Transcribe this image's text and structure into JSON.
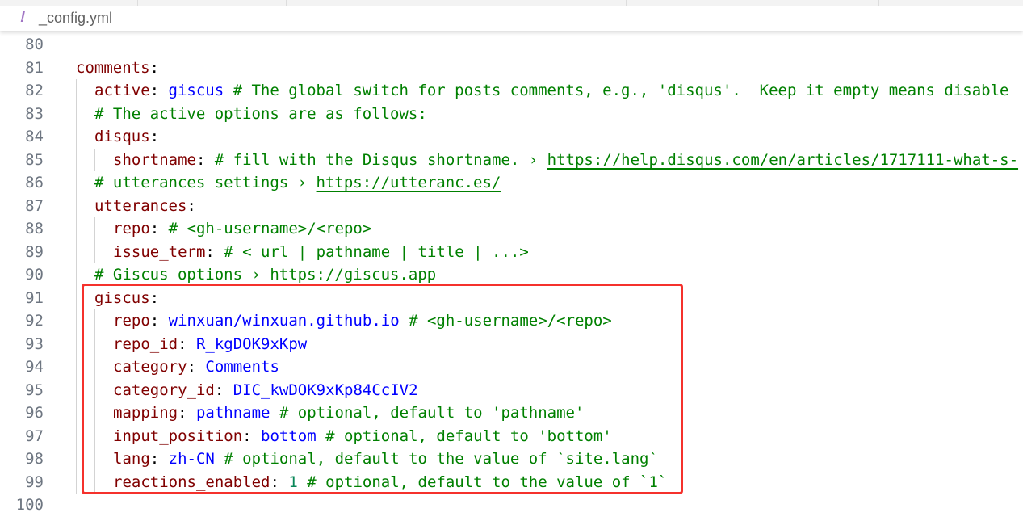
{
  "tab": {
    "filename": "_config.yml",
    "file_icon": "yaml-exclamation-icon",
    "icon_glyph": "!"
  },
  "colors": {
    "key": "#800000",
    "value": "#0000ff",
    "comment": "#008000",
    "number": "#098658",
    "highlight_box": "#f5312c"
  },
  "lines": [
    {
      "num": "80",
      "indent": 0,
      "tokens": []
    },
    {
      "num": "81",
      "indent": 0,
      "tokens": [
        {
          "t": "comments",
          "c": "k"
        },
        {
          "t": ":",
          "c": "p"
        }
      ]
    },
    {
      "num": "82",
      "indent": 1,
      "tokens": [
        {
          "t": "active",
          "c": "k"
        },
        {
          "t": ": ",
          "c": "p"
        },
        {
          "t": "giscus",
          "c": "v"
        },
        {
          "t": " # The global switch for posts comments, e.g., 'disqus'.  Keep it empty means disable",
          "c": "c"
        }
      ]
    },
    {
      "num": "83",
      "indent": 1,
      "tokens": [
        {
          "t": "# The active options are as follows:",
          "c": "c"
        }
      ]
    },
    {
      "num": "84",
      "indent": 1,
      "tokens": [
        {
          "t": "disqus",
          "c": "k"
        },
        {
          "t": ":",
          "c": "p"
        }
      ]
    },
    {
      "num": "85",
      "indent": 2,
      "tokens": [
        {
          "t": "shortname",
          "c": "k"
        },
        {
          "t": ": ",
          "c": "p"
        },
        {
          "t": "# fill with the Disqus shortname. › ",
          "c": "c"
        },
        {
          "t": "https://help.disqus.com/en/articles/1717111-what-s-",
          "c": "c u"
        }
      ]
    },
    {
      "num": "86",
      "indent": 1,
      "tokens": [
        {
          "t": "# utterances settings › ",
          "c": "c"
        },
        {
          "t": "https://utteranc.es/",
          "c": "c u"
        }
      ]
    },
    {
      "num": "87",
      "indent": 1,
      "tokens": [
        {
          "t": "utterances",
          "c": "k"
        },
        {
          "t": ":",
          "c": "p"
        }
      ]
    },
    {
      "num": "88",
      "indent": 2,
      "tokens": [
        {
          "t": "repo",
          "c": "k"
        },
        {
          "t": ": ",
          "c": "p"
        },
        {
          "t": "# <gh-username>/<repo>",
          "c": "c"
        }
      ]
    },
    {
      "num": "89",
      "indent": 2,
      "tokens": [
        {
          "t": "issue_term",
          "c": "k"
        },
        {
          "t": ": ",
          "c": "p"
        },
        {
          "t": "# < url | pathname | title | ...>",
          "c": "c"
        }
      ]
    },
    {
      "num": "90",
      "indent": 1,
      "tokens": [
        {
          "t": "# Giscus options › https://giscus.app",
          "c": "c"
        }
      ]
    },
    {
      "num": "91",
      "indent": 1,
      "tokens": [
        {
          "t": "giscus",
          "c": "k"
        },
        {
          "t": ":",
          "c": "p"
        }
      ]
    },
    {
      "num": "92",
      "indent": 2,
      "tokens": [
        {
          "t": "repo",
          "c": "k"
        },
        {
          "t": ": ",
          "c": "p"
        },
        {
          "t": "winxuan/winxuan.github.io",
          "c": "v"
        },
        {
          "t": " # <gh-username>/<repo>",
          "c": "c"
        }
      ]
    },
    {
      "num": "93",
      "indent": 2,
      "tokens": [
        {
          "t": "repo_id",
          "c": "k"
        },
        {
          "t": ": ",
          "c": "p"
        },
        {
          "t": "R_kgDOK9xKpw",
          "c": "v"
        }
      ]
    },
    {
      "num": "94",
      "indent": 2,
      "tokens": [
        {
          "t": "category",
          "c": "k"
        },
        {
          "t": ": ",
          "c": "p"
        },
        {
          "t": "Comments",
          "c": "v"
        }
      ]
    },
    {
      "num": "95",
      "indent": 2,
      "tokens": [
        {
          "t": "category_id",
          "c": "k"
        },
        {
          "t": ": ",
          "c": "p"
        },
        {
          "t": "DIC_kwDOK9xKp84CcIV2",
          "c": "v"
        }
      ]
    },
    {
      "num": "96",
      "indent": 2,
      "tokens": [
        {
          "t": "mapping",
          "c": "k"
        },
        {
          "t": ": ",
          "c": "p"
        },
        {
          "t": "pathname",
          "c": "v"
        },
        {
          "t": " # optional, default to 'pathname'",
          "c": "c"
        }
      ]
    },
    {
      "num": "97",
      "indent": 2,
      "tokens": [
        {
          "t": "input_position",
          "c": "k"
        },
        {
          "t": ": ",
          "c": "p"
        },
        {
          "t": "bottom",
          "c": "v"
        },
        {
          "t": " # optional, default to 'bottom'",
          "c": "c"
        }
      ]
    },
    {
      "num": "98",
      "indent": 2,
      "tokens": [
        {
          "t": "lang",
          "c": "k"
        },
        {
          "t": ": ",
          "c": "p"
        },
        {
          "t": "zh-CN",
          "c": "v"
        },
        {
          "t": " # optional, default to the value of `site.lang`",
          "c": "c"
        }
      ]
    },
    {
      "num": "99",
      "indent": 2,
      "tokens": [
        {
          "t": "reactions_enabled",
          "c": "k"
        },
        {
          "t": ": ",
          "c": "p"
        },
        {
          "t": "1",
          "c": "n"
        },
        {
          "t": " # optional, default to the value of `1`",
          "c": "c"
        }
      ]
    },
    {
      "num": "100",
      "indent": 0,
      "tokens": []
    }
  ]
}
